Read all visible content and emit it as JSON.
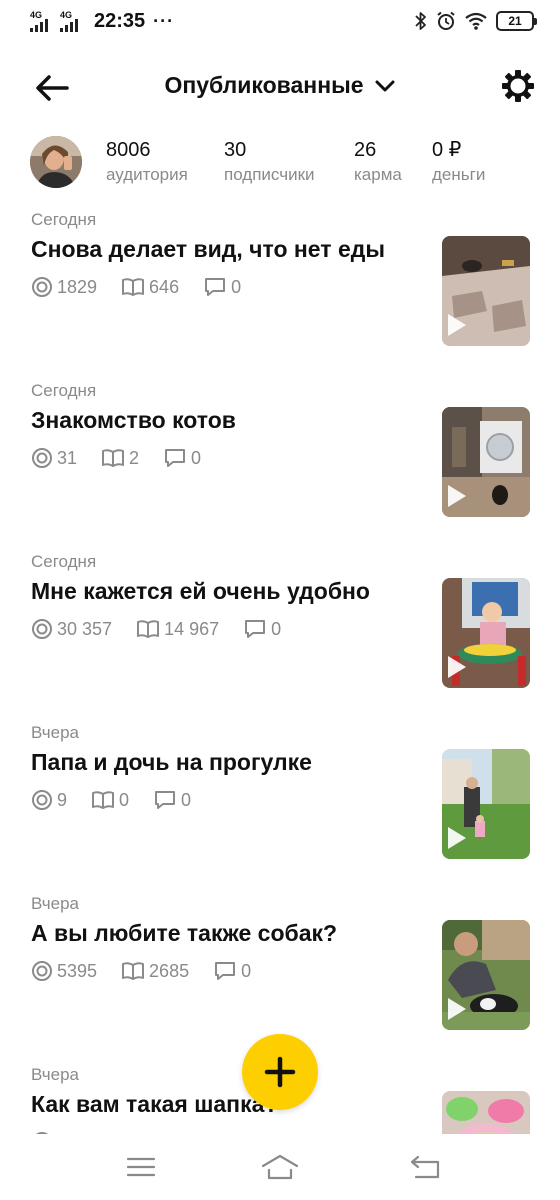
{
  "status_bar": {
    "sim1": "4G",
    "sim2": "4G",
    "time": "22:35",
    "dots": "···",
    "battery": "21",
    "icons": [
      "bluetooth-icon",
      "alarm-icon",
      "wifi-icon",
      "battery-icon"
    ]
  },
  "header": {
    "title": "Опубликованные",
    "icons": [
      "back-arrow-icon",
      "chevron-down-icon",
      "gear-icon"
    ]
  },
  "stats": [
    {
      "value": "8006",
      "label": "аудитория"
    },
    {
      "value": "30",
      "label": "подписчики"
    },
    {
      "value": "26",
      "label": "карма"
    },
    {
      "value": "0 ₽",
      "label": "деньги"
    }
  ],
  "posts": [
    {
      "date": "Сегодня",
      "title": "Снова делает вид, что нет еды",
      "views": "1829",
      "reads": "646",
      "comments": "0"
    },
    {
      "date": "Сегодня",
      "title": "Знакомство котов",
      "views": "31",
      "reads": "2",
      "comments": "0"
    },
    {
      "date": "Сегодня",
      "title": "Мне кажется ей очень удобно",
      "views": "30 357",
      "reads": "14 967",
      "comments": "0"
    },
    {
      "date": "Вчера",
      "title": "Папа и дочь на прогулке",
      "views": "9",
      "reads": "0",
      "comments": "0"
    },
    {
      "date": "Вчера",
      "title": "А вы любите также собак?",
      "views": "5395",
      "reads": "2685",
      "comments": "0"
    },
    {
      "date": "Вчера",
      "title": "Как вам такая шапка?",
      "views": "",
      "reads": "",
      "comments": ""
    }
  ],
  "fab": {
    "icon": "plus-icon",
    "color": "#fdcf00"
  },
  "navbar": {
    "icons": [
      "menu-icon",
      "home-icon",
      "back-icon"
    ]
  }
}
